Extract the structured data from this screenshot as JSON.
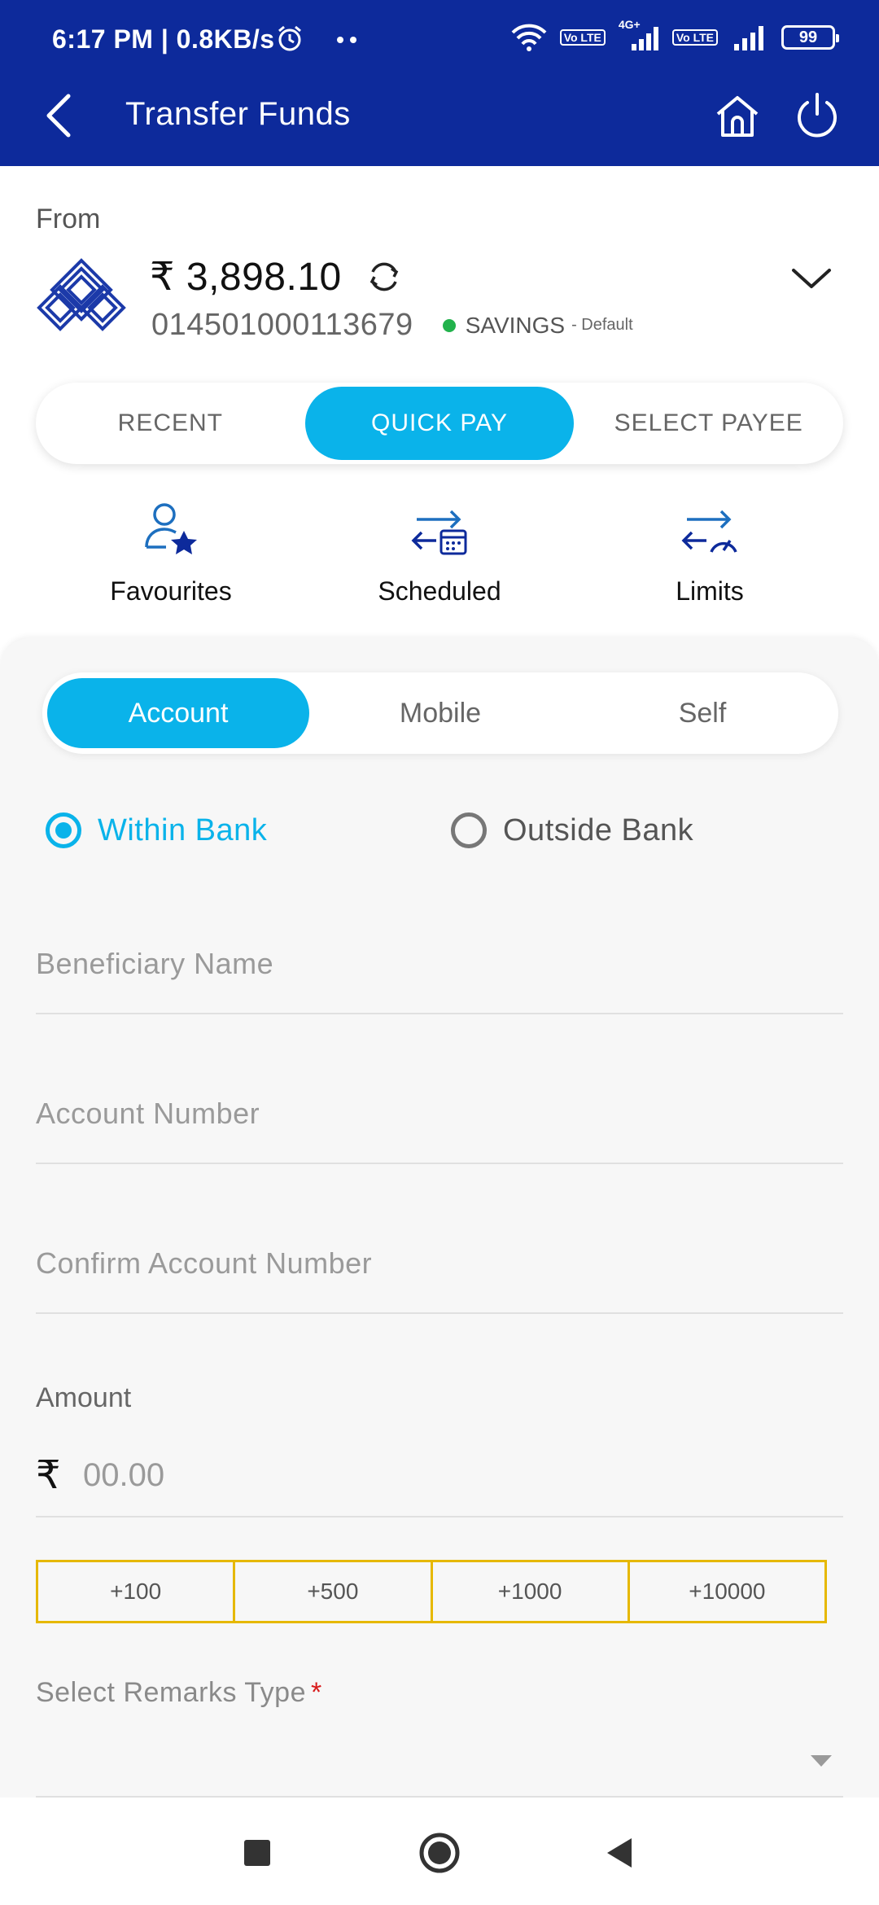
{
  "status_bar": {
    "time": "6:17 PM | 0.8KB/s",
    "network_badge": "4G+",
    "volte_label": "Vo LTE",
    "battery": "99",
    "icons": [
      "alarm-icon",
      "more-dots-icon",
      "wifi-icon",
      "signal-icon",
      "battery-icon"
    ]
  },
  "app_bar": {
    "title": "Transfer Funds",
    "icons": [
      "back-arrow-icon",
      "home-icon",
      "power-icon"
    ]
  },
  "from_account": {
    "label": "From",
    "balance": "₹ 3,898.10",
    "account_number": "014501000113679",
    "account_type": "SAVINGS",
    "default_tag": "- Default",
    "status_color": "#22b24c"
  },
  "payment_tabs": {
    "recent": "RECENT",
    "quick_pay": "QUICK PAY",
    "select_payee": "SELECT PAYEE",
    "active": "QUICK PAY"
  },
  "shortcuts": {
    "favourites": "Favourites",
    "scheduled": "Scheduled",
    "limits": "Limits"
  },
  "transfer_mode_tabs": {
    "account": "Account",
    "mobile": "Mobile",
    "self": "Self",
    "active": "Account"
  },
  "bank_scope": {
    "within": "Within Bank",
    "outside": "Outside Bank",
    "selected": "Within Bank"
  },
  "form": {
    "beneficiary_name": {
      "value": "",
      "placeholder": "Beneficiary Name"
    },
    "account_number": {
      "value": "",
      "placeholder": "Account Number"
    },
    "confirm_account_number": {
      "value": "",
      "placeholder": "Confirm Account Number"
    },
    "amount_label": "Amount",
    "currency_symbol": "₹",
    "amount": {
      "value": "",
      "placeholder": "00.00"
    },
    "quick_amounts": [
      "+100",
      "+500",
      "+1000",
      "+10000"
    ],
    "remarks_label": "Select Remarks Type",
    "required_mark": "*",
    "remarks_value": ""
  },
  "colors": {
    "primary_blue": "#0d2a9b",
    "accent_cyan": "#0ab3ea",
    "quick_amount_border": "#e6b800",
    "required_red": "#d81b1b"
  },
  "nav_bar": {
    "icons": [
      "recents-square-icon",
      "home-circle-icon",
      "back-triangle-icon"
    ]
  }
}
